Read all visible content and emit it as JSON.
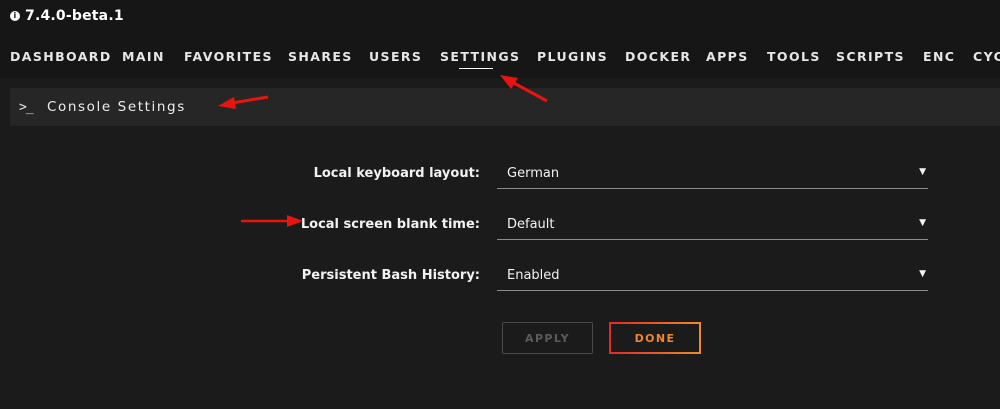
{
  "app": {
    "version": "7.4.0-beta.1"
  },
  "nav": {
    "items": [
      {
        "label": "DASHBOARD",
        "id": "dashboard"
      },
      {
        "label": "MAIN",
        "id": "main"
      },
      {
        "label": "FAVORITES",
        "id": "favorites"
      },
      {
        "label": "SHARES",
        "id": "shares"
      },
      {
        "label": "USERS",
        "id": "users"
      },
      {
        "label": "SETTINGS",
        "id": "settings",
        "active": true
      },
      {
        "label": "PLUGINS",
        "id": "plugins"
      },
      {
        "label": "DOCKER",
        "id": "docker"
      },
      {
        "label": "APPS",
        "id": "apps"
      },
      {
        "label": "TOOLS",
        "id": "tools"
      },
      {
        "label": "SCRIPTS",
        "id": "scripts"
      },
      {
        "label": "ENC",
        "id": "enc"
      },
      {
        "label": "CYC",
        "id": "cyc"
      }
    ]
  },
  "section": {
    "icon": "terminal-icon",
    "icon_glyph": ">_",
    "title": "Console Settings"
  },
  "form": {
    "fields": [
      {
        "label": "Local keyboard layout:",
        "value": "German"
      },
      {
        "label": "Local screen blank time:",
        "value": "Default"
      },
      {
        "label": "Persistent Bash History:",
        "value": "Enabled"
      }
    ],
    "caret_glyph": "▼"
  },
  "buttons": {
    "apply_label": "APPLY",
    "apply_enabled": false,
    "done_label": "DONE"
  },
  "colors": {
    "background": "#1c1b1b",
    "topbar": "#161616",
    "section_header": "#262626",
    "accent_orange": "#f0862c",
    "accent_red": "#e22a28",
    "annotation_arrow": "#e8140f"
  }
}
